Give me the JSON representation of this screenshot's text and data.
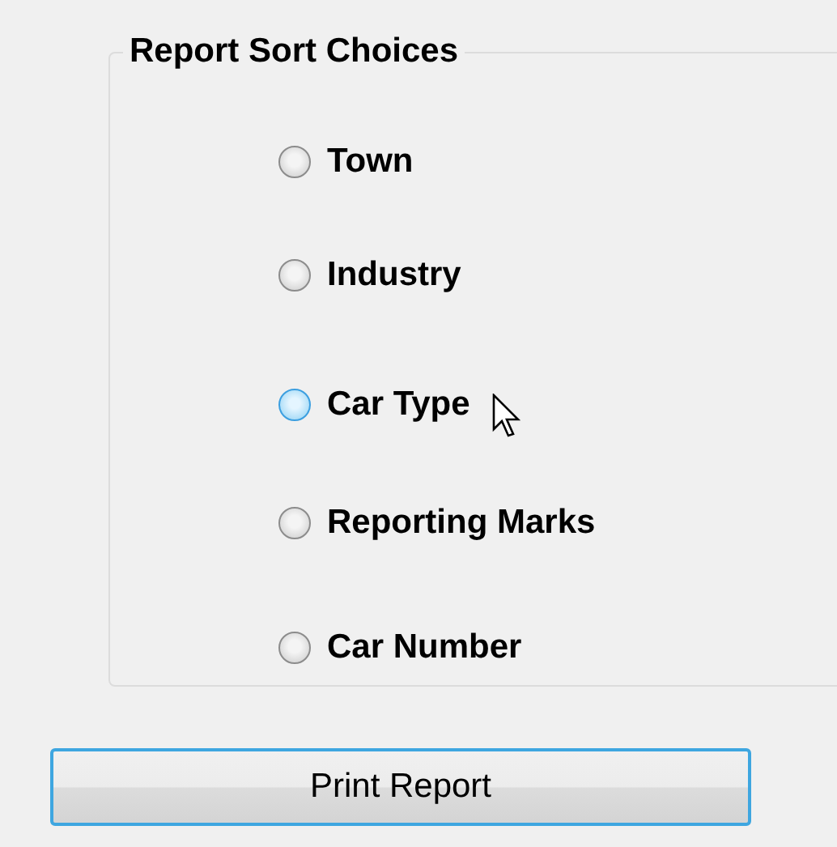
{
  "group": {
    "title": "Report Sort Choices",
    "options": [
      {
        "label": "Town",
        "selected": false,
        "hovered": false
      },
      {
        "label": "Industry",
        "selected": false,
        "hovered": false
      },
      {
        "label": "Car Type",
        "selected": false,
        "hovered": true
      },
      {
        "label": "Reporting Marks",
        "selected": false,
        "hovered": false
      },
      {
        "label": "Car Number",
        "selected": false,
        "hovered": false
      }
    ]
  },
  "button": {
    "label": "Print Report",
    "focused": true
  }
}
